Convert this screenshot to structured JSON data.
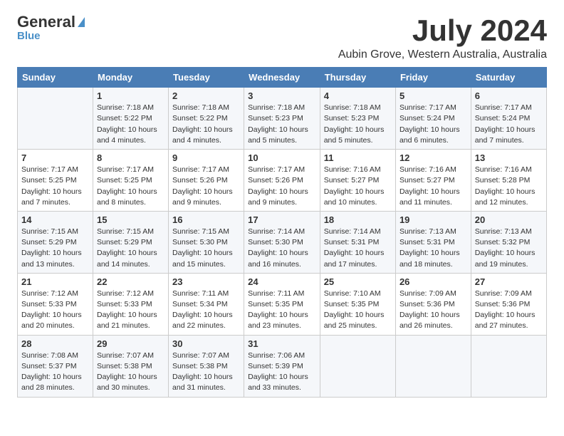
{
  "header": {
    "logo_general": "General",
    "logo_blue": "Blue",
    "month_title": "July 2024",
    "location": "Aubin Grove, Western Australia, Australia"
  },
  "days_of_week": [
    "Sunday",
    "Monday",
    "Tuesday",
    "Wednesday",
    "Thursday",
    "Friday",
    "Saturday"
  ],
  "weeks": [
    [
      {
        "day": "",
        "info": ""
      },
      {
        "day": "1",
        "info": "Sunrise: 7:18 AM\nSunset: 5:22 PM\nDaylight: 10 hours\nand 4 minutes."
      },
      {
        "day": "2",
        "info": "Sunrise: 7:18 AM\nSunset: 5:22 PM\nDaylight: 10 hours\nand 4 minutes."
      },
      {
        "day": "3",
        "info": "Sunrise: 7:18 AM\nSunset: 5:23 PM\nDaylight: 10 hours\nand 5 minutes."
      },
      {
        "day": "4",
        "info": "Sunrise: 7:18 AM\nSunset: 5:23 PM\nDaylight: 10 hours\nand 5 minutes."
      },
      {
        "day": "5",
        "info": "Sunrise: 7:17 AM\nSunset: 5:24 PM\nDaylight: 10 hours\nand 6 minutes."
      },
      {
        "day": "6",
        "info": "Sunrise: 7:17 AM\nSunset: 5:24 PM\nDaylight: 10 hours\nand 7 minutes."
      }
    ],
    [
      {
        "day": "7",
        "info": "Sunrise: 7:17 AM\nSunset: 5:25 PM\nDaylight: 10 hours\nand 7 minutes."
      },
      {
        "day": "8",
        "info": "Sunrise: 7:17 AM\nSunset: 5:25 PM\nDaylight: 10 hours\nand 8 minutes."
      },
      {
        "day": "9",
        "info": "Sunrise: 7:17 AM\nSunset: 5:26 PM\nDaylight: 10 hours\nand 9 minutes."
      },
      {
        "day": "10",
        "info": "Sunrise: 7:17 AM\nSunset: 5:26 PM\nDaylight: 10 hours\nand 9 minutes."
      },
      {
        "day": "11",
        "info": "Sunrise: 7:16 AM\nSunset: 5:27 PM\nDaylight: 10 hours\nand 10 minutes."
      },
      {
        "day": "12",
        "info": "Sunrise: 7:16 AM\nSunset: 5:27 PM\nDaylight: 10 hours\nand 11 minutes."
      },
      {
        "day": "13",
        "info": "Sunrise: 7:16 AM\nSunset: 5:28 PM\nDaylight: 10 hours\nand 12 minutes."
      }
    ],
    [
      {
        "day": "14",
        "info": "Sunrise: 7:15 AM\nSunset: 5:29 PM\nDaylight: 10 hours\nand 13 minutes."
      },
      {
        "day": "15",
        "info": "Sunrise: 7:15 AM\nSunset: 5:29 PM\nDaylight: 10 hours\nand 14 minutes."
      },
      {
        "day": "16",
        "info": "Sunrise: 7:15 AM\nSunset: 5:30 PM\nDaylight: 10 hours\nand 15 minutes."
      },
      {
        "day": "17",
        "info": "Sunrise: 7:14 AM\nSunset: 5:30 PM\nDaylight: 10 hours\nand 16 minutes."
      },
      {
        "day": "18",
        "info": "Sunrise: 7:14 AM\nSunset: 5:31 PM\nDaylight: 10 hours\nand 17 minutes."
      },
      {
        "day": "19",
        "info": "Sunrise: 7:13 AM\nSunset: 5:31 PM\nDaylight: 10 hours\nand 18 minutes."
      },
      {
        "day": "20",
        "info": "Sunrise: 7:13 AM\nSunset: 5:32 PM\nDaylight: 10 hours\nand 19 minutes."
      }
    ],
    [
      {
        "day": "21",
        "info": "Sunrise: 7:12 AM\nSunset: 5:33 PM\nDaylight: 10 hours\nand 20 minutes."
      },
      {
        "day": "22",
        "info": "Sunrise: 7:12 AM\nSunset: 5:33 PM\nDaylight: 10 hours\nand 21 minutes."
      },
      {
        "day": "23",
        "info": "Sunrise: 7:11 AM\nSunset: 5:34 PM\nDaylight: 10 hours\nand 22 minutes."
      },
      {
        "day": "24",
        "info": "Sunrise: 7:11 AM\nSunset: 5:35 PM\nDaylight: 10 hours\nand 23 minutes."
      },
      {
        "day": "25",
        "info": "Sunrise: 7:10 AM\nSunset: 5:35 PM\nDaylight: 10 hours\nand 25 minutes."
      },
      {
        "day": "26",
        "info": "Sunrise: 7:09 AM\nSunset: 5:36 PM\nDaylight: 10 hours\nand 26 minutes."
      },
      {
        "day": "27",
        "info": "Sunrise: 7:09 AM\nSunset: 5:36 PM\nDaylight: 10 hours\nand 27 minutes."
      }
    ],
    [
      {
        "day": "28",
        "info": "Sunrise: 7:08 AM\nSunset: 5:37 PM\nDaylight: 10 hours\nand 28 minutes."
      },
      {
        "day": "29",
        "info": "Sunrise: 7:07 AM\nSunset: 5:38 PM\nDaylight: 10 hours\nand 30 minutes."
      },
      {
        "day": "30",
        "info": "Sunrise: 7:07 AM\nSunset: 5:38 PM\nDaylight: 10 hours\nand 31 minutes."
      },
      {
        "day": "31",
        "info": "Sunrise: 7:06 AM\nSunset: 5:39 PM\nDaylight: 10 hours\nand 33 minutes."
      },
      {
        "day": "",
        "info": ""
      },
      {
        "day": "",
        "info": ""
      },
      {
        "day": "",
        "info": ""
      }
    ]
  ]
}
